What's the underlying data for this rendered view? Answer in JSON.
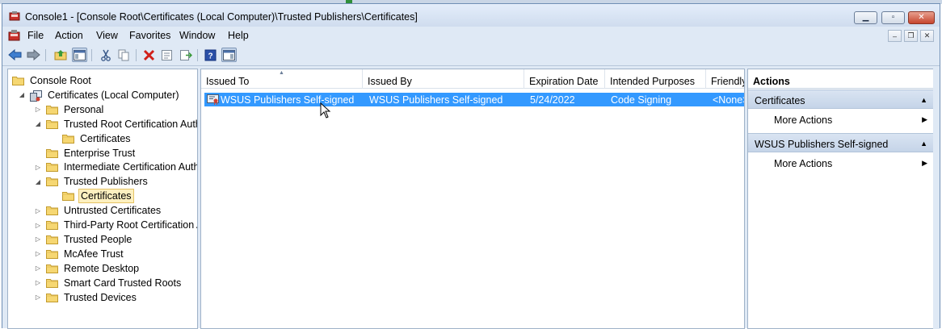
{
  "window": {
    "title": "Console1 - [Console Root\\Certificates (Local Computer)\\Trusted Publishers\\Certificates]"
  },
  "menubar": {
    "items": [
      "File",
      "Action",
      "View",
      "Favorites",
      "Window",
      "Help"
    ]
  },
  "tree": {
    "items": [
      {
        "label": "Console Root",
        "level": 0,
        "expander": "none"
      },
      {
        "label": "Certificates (Local Computer)",
        "level": 1,
        "expander": "open"
      },
      {
        "label": "Personal",
        "level": 2,
        "expander": "closed"
      },
      {
        "label": "Trusted Root Certification Authorities",
        "level": 2,
        "expander": "open"
      },
      {
        "label": "Certificates",
        "level": 3,
        "expander": "none"
      },
      {
        "label": "Enterprise Trust",
        "level": 2,
        "expander": "none"
      },
      {
        "label": "Intermediate Certification Authorities",
        "level": 2,
        "expander": "closed"
      },
      {
        "label": "Trusted Publishers",
        "level": 2,
        "expander": "open"
      },
      {
        "label": "Certificates",
        "level": 3,
        "expander": "none",
        "selected": true
      },
      {
        "label": "Untrusted Certificates",
        "level": 2,
        "expander": "closed"
      },
      {
        "label": "Third-Party Root Certification Authorities",
        "level": 2,
        "expander": "closed"
      },
      {
        "label": "Trusted People",
        "level": 2,
        "expander": "closed"
      },
      {
        "label": "McAfee Trust",
        "level": 2,
        "expander": "closed"
      },
      {
        "label": "Remote Desktop",
        "level": 2,
        "expander": "closed"
      },
      {
        "label": "Smart Card Trusted Roots",
        "level": 2,
        "expander": "closed"
      },
      {
        "label": "Trusted Devices",
        "level": 2,
        "expander": "closed"
      }
    ]
  },
  "list": {
    "columns": [
      "Issued To",
      "Issued By",
      "Expiration Date",
      "Intended Purposes",
      "Friendly Name"
    ],
    "rows": [
      {
        "issued_to": "WSUS Publishers Self-signed",
        "issued_by": "WSUS Publishers Self-signed",
        "expiration": "5/24/2022",
        "purposes": "Code Signing",
        "friendly": "<None>"
      }
    ]
  },
  "actions": {
    "title": "Actions",
    "groups": [
      {
        "label": "Certificates",
        "items": [
          "More Actions"
        ]
      },
      {
        "label": "WSUS Publishers Self-signed",
        "items": [
          "More Actions"
        ]
      }
    ]
  },
  "colors": {
    "selection": "#3399ff",
    "tree_selection": "#fdf0c0",
    "chrome": "#dfe9f5"
  },
  "icons": {
    "back": "back-arrow-icon",
    "forward": "forward-arrow-icon",
    "up": "up-folder-icon",
    "show_hide_tree": "console-tree-icon",
    "cut": "cut-icon",
    "copy": "copy-icon",
    "delete": "delete-icon",
    "properties": "properties-icon",
    "export": "export-list-icon",
    "help": "help-icon",
    "action_pane": "action-pane-icon"
  }
}
